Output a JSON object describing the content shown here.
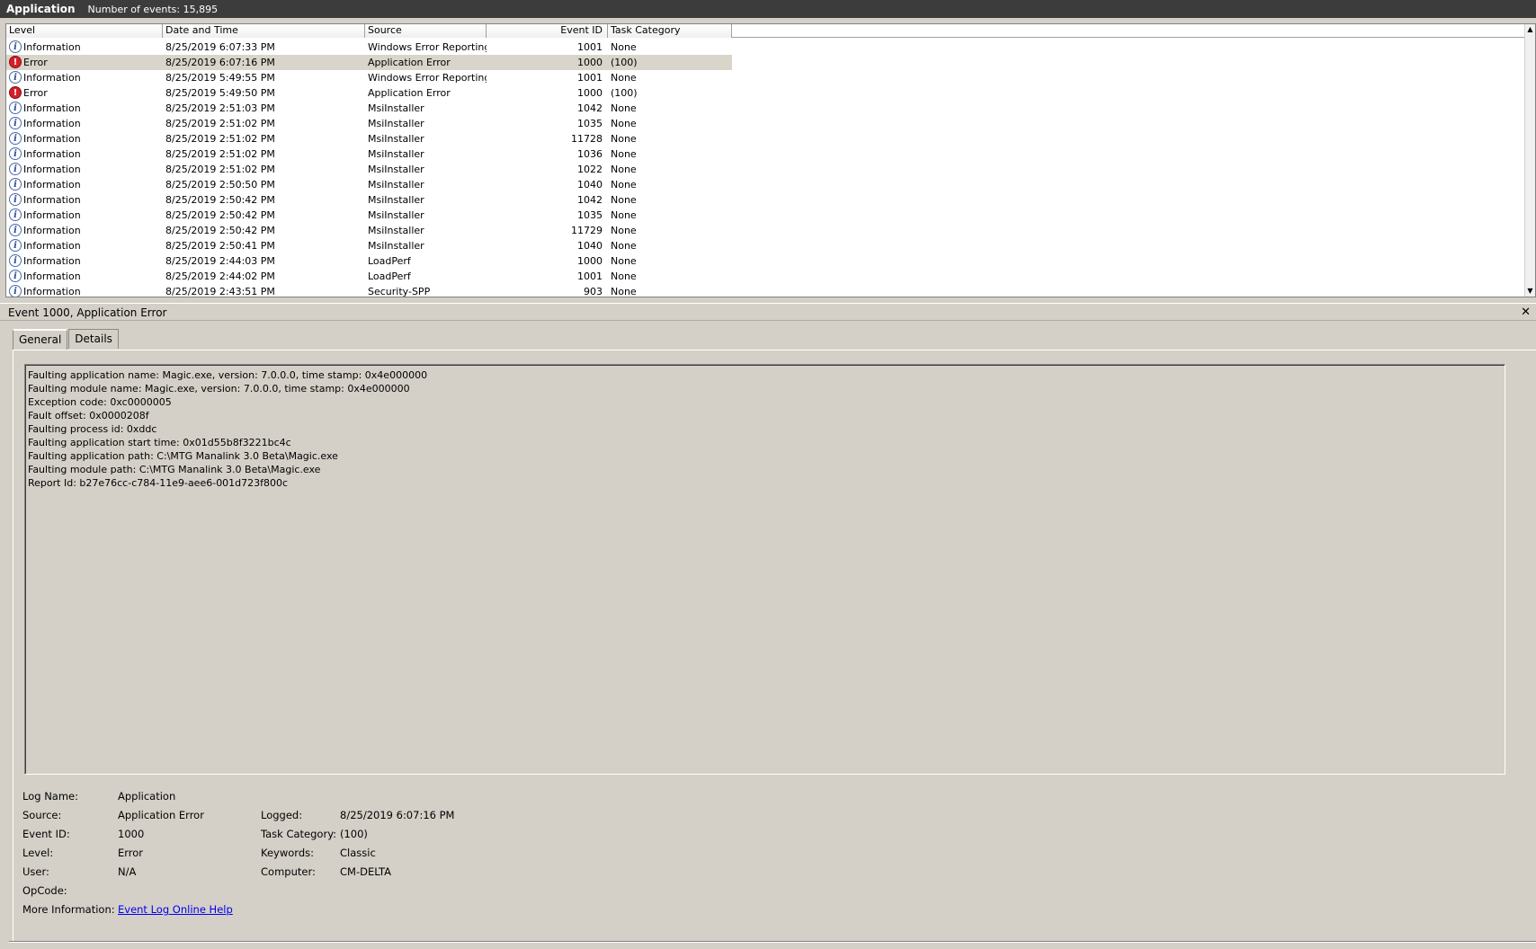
{
  "title": {
    "app": "Application",
    "count": "Number of events: 15,895"
  },
  "grid": {
    "columns": [
      "Level",
      "Date and Time",
      "Source",
      "Event ID",
      "Task Category"
    ],
    "rows": [
      {
        "level": "Information",
        "type": "info",
        "date": "8/25/2019 6:07:33 PM",
        "source": "Windows Error Reporting",
        "id": "1001",
        "cat": "None"
      },
      {
        "level": "Error",
        "type": "error",
        "date": "8/25/2019 6:07:16 PM",
        "source": "Application Error",
        "id": "1000",
        "cat": "(100)"
      },
      {
        "level": "Information",
        "type": "info",
        "date": "8/25/2019 5:49:55 PM",
        "source": "Windows Error Reporting",
        "id": "1001",
        "cat": "None"
      },
      {
        "level": "Error",
        "type": "error",
        "date": "8/25/2019 5:49:50 PM",
        "source": "Application Error",
        "id": "1000",
        "cat": "(100)"
      },
      {
        "level": "Information",
        "type": "info",
        "date": "8/25/2019 2:51:03 PM",
        "source": "MsiInstaller",
        "id": "1042",
        "cat": "None"
      },
      {
        "level": "Information",
        "type": "info",
        "date": "8/25/2019 2:51:02 PM",
        "source": "MsiInstaller",
        "id": "1035",
        "cat": "None"
      },
      {
        "level": "Information",
        "type": "info",
        "date": "8/25/2019 2:51:02 PM",
        "source": "MsiInstaller",
        "id": "11728",
        "cat": "None"
      },
      {
        "level": "Information",
        "type": "info",
        "date": "8/25/2019 2:51:02 PM",
        "source": "MsiInstaller",
        "id": "1036",
        "cat": "None"
      },
      {
        "level": "Information",
        "type": "info",
        "date": "8/25/2019 2:51:02 PM",
        "source": "MsiInstaller",
        "id": "1022",
        "cat": "None"
      },
      {
        "level": "Information",
        "type": "info",
        "date": "8/25/2019 2:50:50 PM",
        "source": "MsiInstaller",
        "id": "1040",
        "cat": "None"
      },
      {
        "level": "Information",
        "type": "info",
        "date": "8/25/2019 2:50:42 PM",
        "source": "MsiInstaller",
        "id": "1042",
        "cat": "None"
      },
      {
        "level": "Information",
        "type": "info",
        "date": "8/25/2019 2:50:42 PM",
        "source": "MsiInstaller",
        "id": "1035",
        "cat": "None"
      },
      {
        "level": "Information",
        "type": "info",
        "date": "8/25/2019 2:50:42 PM",
        "source": "MsiInstaller",
        "id": "11729",
        "cat": "None"
      },
      {
        "level": "Information",
        "type": "info",
        "date": "8/25/2019 2:50:41 PM",
        "source": "MsiInstaller",
        "id": "1040",
        "cat": "None"
      },
      {
        "level": "Information",
        "type": "info",
        "date": "8/25/2019 2:44:03 PM",
        "source": "LoadPerf",
        "id": "1000",
        "cat": "None"
      },
      {
        "level": "Information",
        "type": "info",
        "date": "8/25/2019 2:44:02 PM",
        "source": "LoadPerf",
        "id": "1001",
        "cat": "None"
      },
      {
        "level": "Information",
        "type": "info",
        "date": "8/25/2019 2:43:51 PM",
        "source": "Security-SPP",
        "id": "903",
        "cat": "None"
      }
    ],
    "selected_index": 1,
    "icon_names": {
      "info": "information-icon",
      "error": "error-icon"
    }
  },
  "detail": {
    "header": "Event 1000, Application Error",
    "close_glyph": "✕",
    "tabs": [
      "General",
      "Details"
    ],
    "description": [
      "Faulting application name: Magic.exe, version: 7.0.0.0, time stamp: 0x4e000000",
      "Faulting module name: Magic.exe, version: 7.0.0.0, time stamp: 0x4e000000",
      "Exception code: 0xc0000005",
      "Fault offset: 0x0000208f",
      "Faulting process id: 0xddc",
      "Faulting application start time: 0x01d55b8f3221bc4c",
      "Faulting application path: C:\\MTG Manalink 3.0 Beta\\Magic.exe",
      "Faulting module path: C:\\MTG Manalink 3.0 Beta\\Magic.exe",
      "Report Id: b27e76cc-c784-11e9-aee6-001d723f800c"
    ],
    "props": {
      "log_name_label": "Log Name:",
      "log_name": "Application",
      "source_label": "Source:",
      "source": "Application Error",
      "logged_label": "Logged:",
      "logged": "8/25/2019 6:07:16 PM",
      "event_id_label": "Event ID:",
      "event_id": "1000",
      "task_cat_label": "Task Category:",
      "task_cat": "(100)",
      "level_label": "Level:",
      "level": "Error",
      "keywords_label": "Keywords:",
      "keywords": "Classic",
      "user_label": "User:",
      "user": "N/A",
      "computer_label": "Computer:",
      "computer": "CM-DELTA",
      "opcode_label": "OpCode:",
      "opcode": "",
      "more_info_label": "More Information:",
      "more_info_link": "Event Log Online Help"
    }
  }
}
